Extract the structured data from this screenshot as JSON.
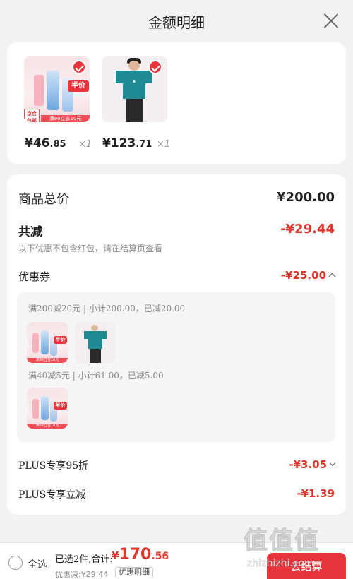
{
  "header": {
    "title": "金额明细"
  },
  "products": [
    {
      "price_int": "¥46",
      "price_dec": ".85",
      "qty": "×1",
      "jd_tag": "京仓包邮",
      "half_price": "半价",
      "promo": "满99立省10元"
    },
    {
      "price_int": "¥123",
      "price_dec": ".71",
      "qty": "×1"
    }
  ],
  "detail": {
    "goods_total_label": "商品总价",
    "goods_total_value": "¥200.00",
    "reduce_label": "共减",
    "reduce_value": "-¥29.44",
    "reduce_note": "以下优惠不包含红包，请在结算页查看",
    "coupon_label": "优惠券",
    "coupon_value": "-¥25.00",
    "coupons": [
      {
        "line": "满200减20元 | 小计200.00，已减20.00"
      },
      {
        "line": "满40减5元 | 小计61.00，已减5.00"
      }
    ],
    "plus95_label": "PLUS专享95折",
    "plus95_value": "-¥3.05",
    "plus_instant_label": "PLUS专享立减",
    "plus_instant_value": "-¥1.39"
  },
  "bottom": {
    "select_all": "全选",
    "summary": "已选2件,合计:",
    "total_yen": "¥",
    "total_int": "170",
    "total_dec": ".56",
    "discount": "优惠减:¥29.44",
    "detail_button": "优惠明细",
    "checkout": "去结算"
  },
  "watermark": {
    "text": "值值值",
    "url": "zhizhizhi.com"
  },
  "colors": {
    "accent": "#e8343b",
    "price_red": "#e0352b",
    "background": "#f2f2f2"
  }
}
